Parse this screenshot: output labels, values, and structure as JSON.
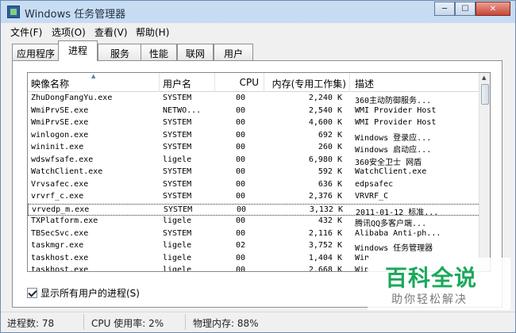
{
  "window": {
    "title": "Windows 任务管理器"
  },
  "window_buttons": {
    "minimize": "─",
    "maximize": "☐",
    "close": "✕"
  },
  "menu": [
    "文件(F)",
    "选项(O)",
    "查看(V)",
    "帮助(H)"
  ],
  "tabs": [
    {
      "label": "应用程序",
      "active": false
    },
    {
      "label": "进程",
      "active": true
    },
    {
      "label": "服务",
      "active": false
    },
    {
      "label": "性能",
      "active": false
    },
    {
      "label": "联网",
      "active": false
    },
    {
      "label": "用户",
      "active": false
    }
  ],
  "columns": {
    "name": "映像名称",
    "user": "用户名",
    "cpu": "CPU",
    "mem": "内存(专用工作集)",
    "desc": "描述"
  },
  "processes": [
    {
      "name": "ZhuDongFangYu.exe",
      "user": "SYSTEM",
      "cpu": "00",
      "mem": "2,240 K",
      "desc": "360主动防御服务...",
      "selected": false
    },
    {
      "name": "WmiPrvSE.exe",
      "user": "NETWO...",
      "cpu": "00",
      "mem": "2,540 K",
      "desc": "WMI Provider Host",
      "selected": false
    },
    {
      "name": "WmiPrvSE.exe",
      "user": "SYSTEM",
      "cpu": "00",
      "mem": "4,600 K",
      "desc": "WMI Provider Host",
      "selected": false
    },
    {
      "name": "winlogon.exe",
      "user": "SYSTEM",
      "cpu": "00",
      "mem": "692 K",
      "desc": "Windows 登录应...",
      "selected": false
    },
    {
      "name": "wininit.exe",
      "user": "SYSTEM",
      "cpu": "00",
      "mem": "260 K",
      "desc": "Windows 启动应...",
      "selected": false
    },
    {
      "name": "wdswfsafe.exe",
      "user": "ligele",
      "cpu": "00",
      "mem": "6,980 K",
      "desc": "360安全卫士 网盾",
      "selected": false
    },
    {
      "name": "WatchClient.exe",
      "user": "SYSTEM",
      "cpu": "00",
      "mem": "592 K",
      "desc": "WatchClient.exe",
      "selected": false
    },
    {
      "name": "Vrvsafec.exe",
      "user": "SYSTEM",
      "cpu": "00",
      "mem": "636 K",
      "desc": "edpsafec",
      "selected": false
    },
    {
      "name": "vrvrf_c.exe",
      "user": "SYSTEM",
      "cpu": "00",
      "mem": "2,376 K",
      "desc": "VRVRF_C",
      "selected": false
    },
    {
      "name": "vrvedp_m.exe",
      "user": "SYSTEM",
      "cpu": "00",
      "mem": "3,132 K",
      "desc": "2011-01-12 标准...",
      "selected": true
    },
    {
      "name": "TXPlatform.exe",
      "user": "ligele",
      "cpu": "00",
      "mem": "432 K",
      "desc": "腾讯QQ多客户端...",
      "selected": false
    },
    {
      "name": "TBSecSvc.exe",
      "user": "SYSTEM",
      "cpu": "00",
      "mem": "2,116 K",
      "desc": "Alibaba Anti-ph...",
      "selected": false
    },
    {
      "name": "taskmgr.exe",
      "user": "ligele",
      "cpu": "02",
      "mem": "3,752 K",
      "desc": "Windows 任务管理器",
      "selected": false
    },
    {
      "name": "taskhost.exe",
      "user": "ligele",
      "cpu": "00",
      "mem": "1,404 K",
      "desc": "Win",
      "selected": false
    },
    {
      "name": "taskhost.exe",
      "user": "ligele",
      "cpu": "00",
      "mem": "2,668 K",
      "desc": "Win",
      "selected": false
    }
  ],
  "show_all_users": {
    "label": "显示所有用户的进程(S)",
    "checked": true
  },
  "status": {
    "processes": "进程数: 78",
    "cpu": "CPU 使用率: 2%",
    "memory": "物理内存: 88%"
  },
  "watermark": {
    "title": "百科全说",
    "subtitle": "助你轻松解决"
  }
}
